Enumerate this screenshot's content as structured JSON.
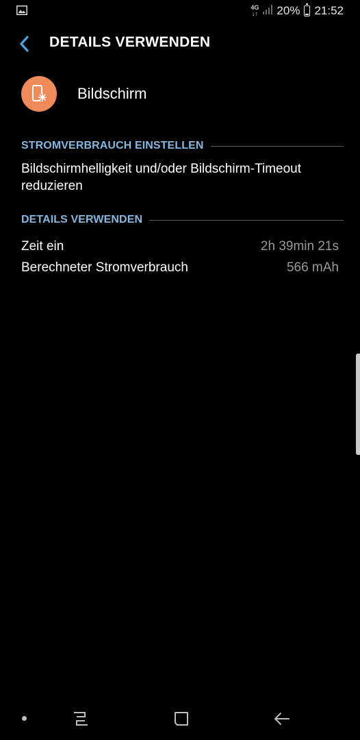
{
  "status_bar": {
    "network_type_top": "4G",
    "network_type_bottom": "↓↑",
    "battery_percent": "20%",
    "battery_level": 0.2,
    "time": "21:52",
    "icons": [
      "gallery-notification-icon",
      "signal-icon",
      "battery-icon"
    ]
  },
  "header": {
    "title": "DETAILS VERWENDEN",
    "back_icon": "back-chevron-icon"
  },
  "app": {
    "name": "Bildschirm",
    "icon": "screen-settings-icon",
    "icon_color": "#ef8b5b"
  },
  "sections": {
    "power_settings": {
      "title": "STROMVERBRAUCH EINSTELLEN",
      "suggestion": "Bildschirmhelligkeit und/oder Bildschirm-Timeout reduzieren"
    },
    "usage_details": {
      "title": "DETAILS VERWENDEN",
      "rows": [
        {
          "label": "Zeit ein",
          "value": "2h 39min 21s"
        },
        {
          "label": "Berechneter Stromverbrauch",
          "value": "566 mAh"
        }
      ]
    }
  },
  "nav_bar": {
    "icons": [
      "nav-dot-icon",
      "recents-icon",
      "home-icon",
      "back-arrow-icon"
    ]
  },
  "colors": {
    "accent": "#86b7e0",
    "back_chevron": "#4aa3e0",
    "background": "#000000",
    "secondary_text": "#9a9a9a"
  }
}
